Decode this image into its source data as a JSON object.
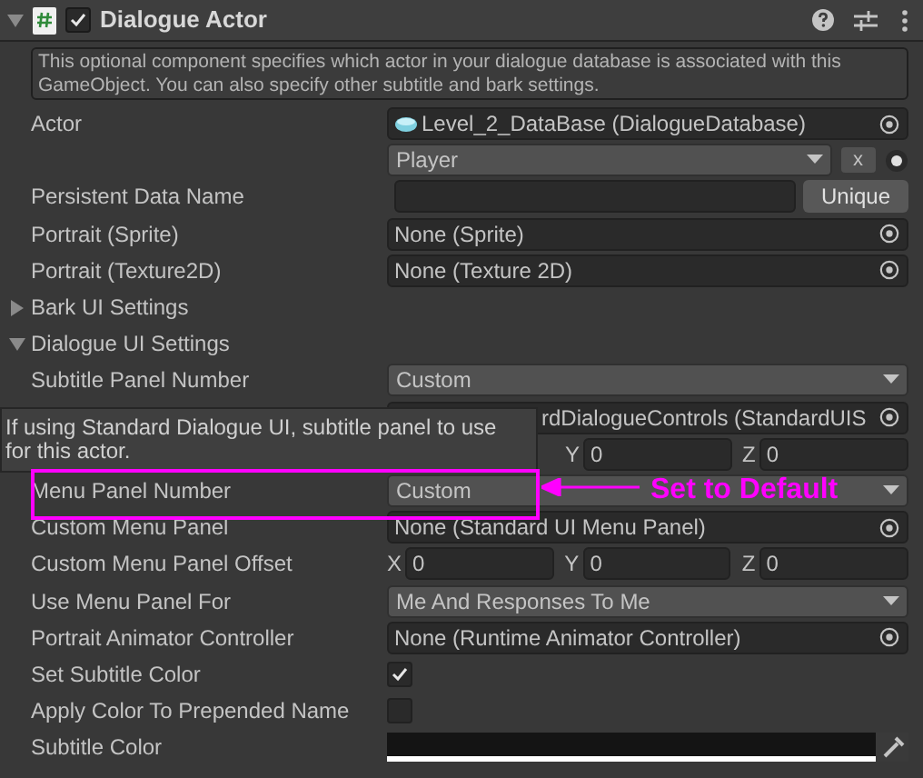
{
  "header": {
    "title": "Dialogue Actor",
    "enabled": true
  },
  "description": "This optional component specifies which actor in your dialogue database is associated with this GameObject. You can also specify other subtitle and bark settings.",
  "rows": [
    {
      "kind": "database",
      "label": "Actor",
      "value": "Level_2_DataBase (DialogueDatabase)"
    },
    {
      "kind": "actor-popup",
      "value": "Player",
      "button": "x"
    },
    {
      "kind": "text-button",
      "label": "Persistent Data Name",
      "button": "Unique"
    },
    {
      "kind": "object",
      "label": "Portrait (Sprite)",
      "value": "None (Sprite)"
    },
    {
      "kind": "object",
      "label": "Portrait (Texture2D)",
      "value": "None (Texture 2D)"
    },
    {
      "kind": "foldout",
      "label": "Bark UI Settings",
      "expanded": false
    },
    {
      "kind": "foldout",
      "label": "Dialogue UI Settings",
      "expanded": true
    },
    {
      "kind": "popup",
      "label": "Subtitle Panel Number",
      "value": "Custom"
    },
    {
      "kind": "object-partial",
      "value": "rdDialogueControls (StandardUIS"
    },
    {
      "kind": "vector-partial",
      "fields": [
        {
          "axis": "Y",
          "value": "0"
        },
        {
          "axis": "Z",
          "value": "0"
        }
      ]
    },
    {
      "kind": "popup",
      "label": "Menu Panel Number",
      "value": "Custom"
    },
    {
      "kind": "object",
      "label": "Custom Menu Panel",
      "value": "None (Standard UI Menu Panel)"
    },
    {
      "kind": "vector",
      "label": "Custom Menu Panel Offset",
      "fields": [
        {
          "axis": "X",
          "value": "0"
        },
        {
          "axis": "Y",
          "value": "0"
        },
        {
          "axis": "Z",
          "value": "0"
        }
      ]
    },
    {
      "kind": "popup",
      "label": "Use Menu Panel For",
      "value": "Me And Responses To Me"
    },
    {
      "kind": "object",
      "label": "Portrait Animator Controller",
      "value": "None (Runtime Animator Controller)"
    },
    {
      "kind": "checkbox",
      "label": "Set Subtitle Color",
      "checked": true
    },
    {
      "kind": "checkbox",
      "label": "Apply Color To Prepended Name",
      "checked": false
    },
    {
      "kind": "color",
      "label": "Subtitle Color",
      "color": "#141414"
    }
  ],
  "tooltip": "If using Standard Dialogue UI, subtitle panel to use for this actor.",
  "annotation": {
    "text": "Set to Default"
  }
}
